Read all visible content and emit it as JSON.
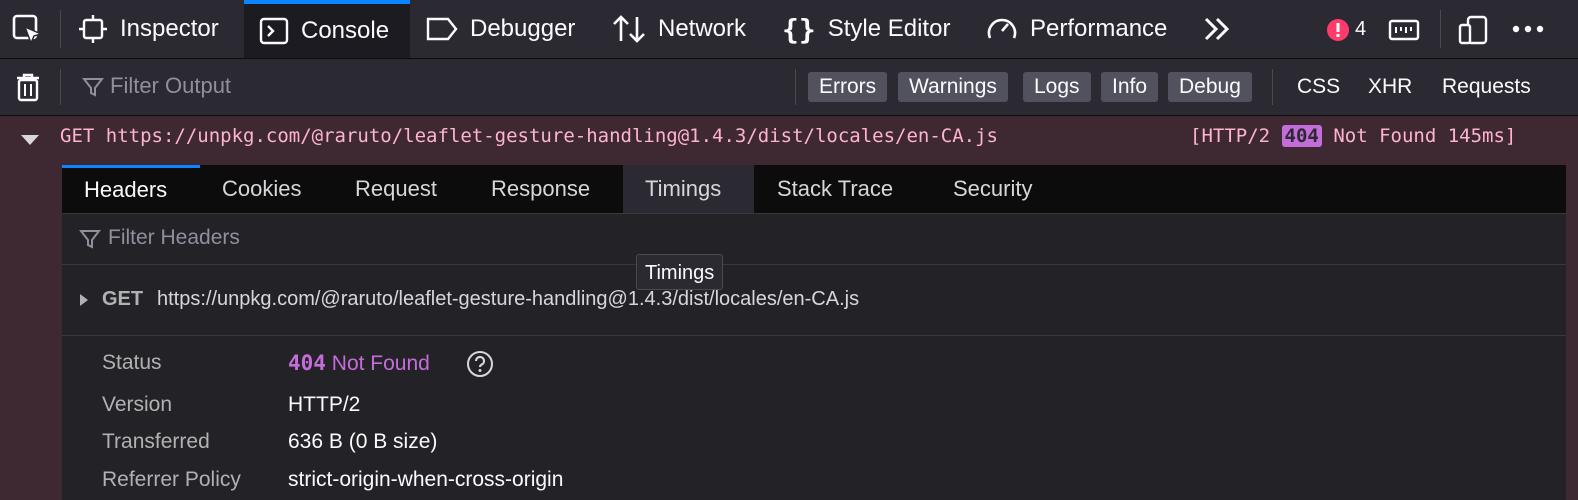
{
  "toolbar": {
    "tabs": [
      {
        "label": "Inspector",
        "icon": "inspector-icon"
      },
      {
        "label": "Console",
        "icon": "console-icon"
      },
      {
        "label": "Debugger",
        "icon": "debugger-icon"
      },
      {
        "label": "Network",
        "icon": "network-icon"
      },
      {
        "label": "Style Editor",
        "icon": "style-editor-icon"
      },
      {
        "label": "Performance",
        "icon": "performance-icon"
      }
    ],
    "error_count": "4"
  },
  "filterbar": {
    "placeholder": "Filter Output",
    "buttons": [
      "Errors",
      "Warnings",
      "Logs",
      "Info",
      "Debug"
    ],
    "types": [
      "CSS",
      "XHR",
      "Requests"
    ]
  },
  "message": {
    "text": "GET https://unpkg.com/@raruto/leaflet-gesture-handling@1.4.3/dist/locales/en-CA.js",
    "status_prefix": "[HTTP/2",
    "status_code": "404",
    "status_suffix": "Not Found 145ms]"
  },
  "panel": {
    "tabs": [
      "Headers",
      "Cookies",
      "Request",
      "Response",
      "Timings",
      "Stack Trace",
      "Security"
    ],
    "filter_placeholder": "Filter Headers",
    "tooltip": "Timings",
    "request": {
      "method": "GET",
      "url": "https://unpkg.com/@raruto/leaflet-gesture-handling@1.4.3/dist/locales/en-CA.js"
    },
    "rows": {
      "status_label": "Status",
      "status_code": "404",
      "status_text": "Not Found",
      "version_label": "Version",
      "version_value": "HTTP/2",
      "transferred_label": "Transferred",
      "transferred_value": "636 B (0 B size)",
      "referrer_label": "Referrer Policy",
      "referrer_value": "strict-origin-when-cross-origin"
    }
  },
  "colors": {
    "accent": "#0a84ff",
    "error_bg": "#3e2832",
    "error_text": "#ffb3d2",
    "status_purple": "#c56cdb",
    "error_badge": "#ff3b6b"
  }
}
